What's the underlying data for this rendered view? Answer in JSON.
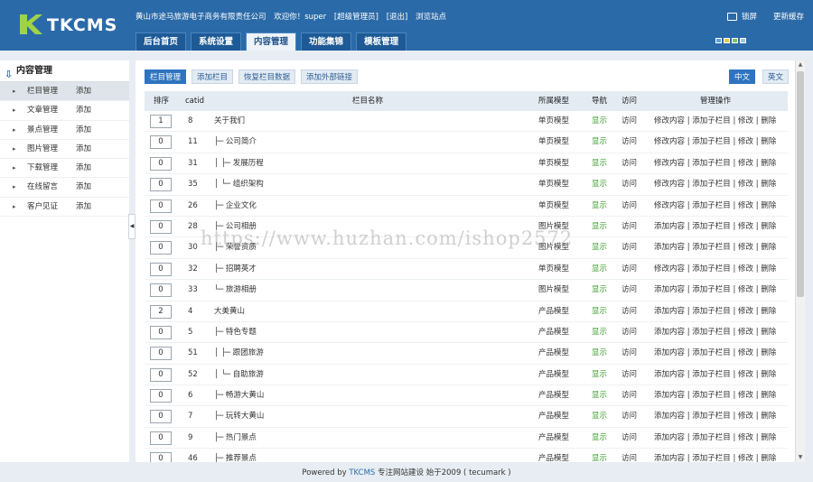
{
  "header": {
    "logo_text": "TKCMS",
    "company": "黄山市途马旅游电子商务有限责任公司",
    "welcome": "欢迎你！super",
    "role": "[超级管理员]",
    "logout": "[退出]",
    "browse": "浏览站点",
    "lock": "锁屏",
    "update_cache": "更新缓存",
    "tabs": [
      "后台首页",
      "系统设置",
      "内容管理",
      "功能集锦",
      "模板管理"
    ],
    "active_tab": "内容管理",
    "skin_colors": [
      "#5aa0e0",
      "#e8c84a",
      "#7cc26a",
      "#9ec3e8"
    ],
    "brand_color": "#2b6aa8"
  },
  "sidebar": {
    "title": "内容管理",
    "add_label": "添加",
    "items": [
      {
        "label": "栏目管理",
        "active": true
      },
      {
        "label": "文章管理"
      },
      {
        "label": "景点管理"
      },
      {
        "label": "图片管理"
      },
      {
        "label": "下载管理"
      },
      {
        "label": "在线留言"
      },
      {
        "label": "客户见证"
      }
    ]
  },
  "toolbar": {
    "buttons": [
      "栏目管理",
      "添加栏目",
      "恢复栏目数据",
      "添加外部链接"
    ],
    "langs": [
      "中文",
      "英文"
    ]
  },
  "table": {
    "headers": {
      "sort": "排序",
      "catid": "catid",
      "name": "栏目名称",
      "model": "所属模型",
      "nav": "导航",
      "visit": "访问",
      "ops": "管理操作"
    },
    "nav_label": "显示",
    "visit_label": "访问",
    "rows": [
      {
        "sort": "1",
        "catid": "8",
        "name": "关于我们",
        "model": "单页模型",
        "op1": "修改内容"
      },
      {
        "sort": "0",
        "catid": "11",
        "name": "├─ 公司简介",
        "model": "单页模型",
        "op1": "修改内容"
      },
      {
        "sort": "0",
        "catid": "31",
        "name": "│    ├─ 发展历程",
        "model": "单页模型",
        "op1": "修改内容"
      },
      {
        "sort": "0",
        "catid": "35",
        "name": "│    └─ 组织架构",
        "model": "单页模型",
        "op1": "修改内容"
      },
      {
        "sort": "0",
        "catid": "26",
        "name": "├─ 企业文化",
        "model": "单页模型",
        "op1": "修改内容"
      },
      {
        "sort": "0",
        "catid": "28",
        "name": "├─ 公司相册",
        "model": "图片模型",
        "op1": "添加内容"
      },
      {
        "sort": "0",
        "catid": "30",
        "name": "├─ 荣誉资质",
        "model": "图片模型",
        "op1": "添加内容"
      },
      {
        "sort": "0",
        "catid": "32",
        "name": "├─ 招聘英才",
        "model": "单页模型",
        "op1": "修改内容"
      },
      {
        "sort": "0",
        "catid": "33",
        "name": "└─ 旅游相册",
        "model": "图片模型",
        "op1": "添加内容"
      },
      {
        "sort": "2",
        "catid": "4",
        "name": "大美黄山",
        "model": "产品模型",
        "op1": "添加内容"
      },
      {
        "sort": "0",
        "catid": "5",
        "name": "├─ 特色专题",
        "model": "产品模型",
        "op1": "添加内容"
      },
      {
        "sort": "0",
        "catid": "51",
        "name": "│    ├─ 跟团旅游",
        "model": "产品模型",
        "op1": "添加内容"
      },
      {
        "sort": "0",
        "catid": "52",
        "name": "│    └─ 自助旅游",
        "model": "产品模型",
        "op1": "添加内容"
      },
      {
        "sort": "0",
        "catid": "6",
        "name": "├─ 畅游大黄山",
        "model": "产品模型",
        "op1": "添加内容"
      },
      {
        "sort": "0",
        "catid": "7",
        "name": "├─ 玩转大黄山",
        "model": "产品模型",
        "op1": "添加内容"
      },
      {
        "sort": "0",
        "catid": "9",
        "name": "├─ 热门景点",
        "model": "产品模型",
        "op1": "添加内容"
      },
      {
        "sort": "0",
        "catid": "46",
        "name": "├─ 推荐景点",
        "model": "产品模型",
        "op1": "添加内容"
      }
    ],
    "op_rest": "| 添加子栏目 | 修改 | 删除"
  },
  "watermark": "https://www.huzhan.com/ishop2572",
  "footer": {
    "powered": "Powered by",
    "brand": "TKCMS",
    "rest": "专注网站建设  始于2009 ( tecumark )"
  }
}
